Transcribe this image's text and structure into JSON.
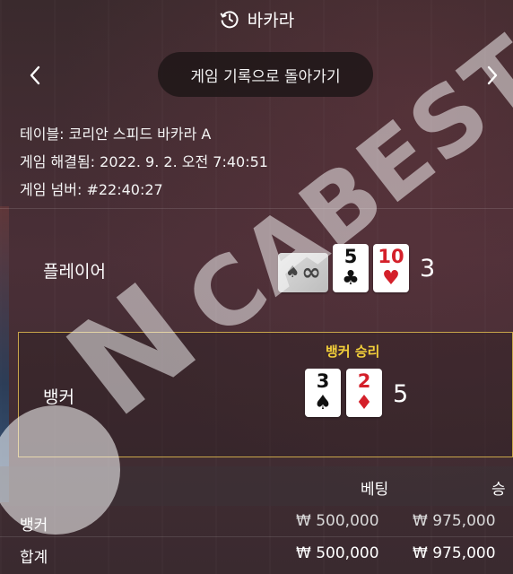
{
  "header": {
    "title": "바카라",
    "icon": "history-icon"
  },
  "nav": {
    "back_label": "게임 기록으로 돌아가기",
    "prev_icon": "chevron-left-icon",
    "next_icon": "chevron-right-icon"
  },
  "info": {
    "table": "테이블: 코리안 스피드 바카라 A",
    "resolved": "게임 해결됨: 2022. 9. 2. 오전 7:40:51",
    "game_number": "게임 넘버: #22:40:27"
  },
  "player": {
    "label": "플레이어",
    "score": "3",
    "cards": [
      {
        "rank": "",
        "suit": "♠",
        "back": true,
        "color": "black"
      },
      {
        "rank": "5",
        "suit": "♣",
        "back": false,
        "color": "black"
      },
      {
        "rank": "10",
        "suit": "♥",
        "back": false,
        "color": "red"
      }
    ]
  },
  "banker": {
    "label": "뱅커",
    "score": "5",
    "win_label": "뱅커 승리",
    "cards": [
      {
        "rank": "3",
        "suit": "♠",
        "color": "black"
      },
      {
        "rank": "2",
        "suit": "♦",
        "color": "red"
      }
    ]
  },
  "bets": {
    "col_bet": "베팅",
    "col_win": "승",
    "rows": [
      {
        "name": "뱅커",
        "bet": "₩ 500,000",
        "win": "₩ 975,000"
      },
      {
        "name": "합계",
        "bet": "₩ 500,000",
        "win": "₩ 975,000"
      }
    ]
  },
  "watermark": {
    "text": "NCABEST"
  },
  "colors": {
    "accent_gold": "#c9a64a",
    "win_yellow": "#f2cf3a",
    "red_suit": "#d4202a"
  }
}
